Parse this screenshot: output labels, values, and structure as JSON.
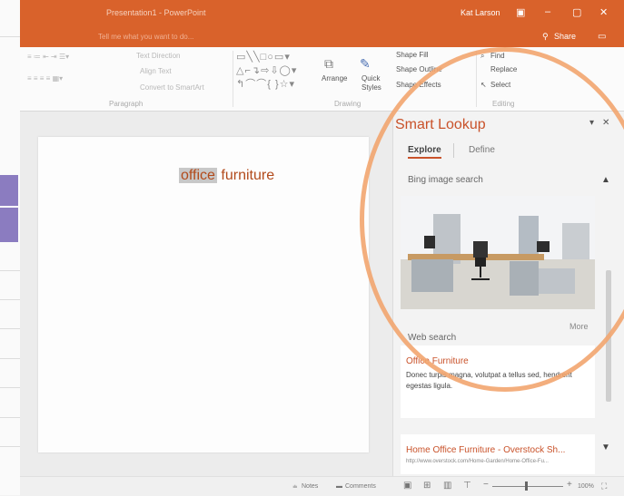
{
  "window": {
    "title": "Presentation1 - PowerPoint",
    "user": "Kat Larson",
    "controls": {
      "restore": "▣",
      "minimize": "–",
      "maximize": "▢",
      "close": "✕"
    }
  },
  "tabs": {
    "tell_me": "Tell me what you want to do...",
    "share_icon": "person-icon",
    "share_label": "Share",
    "comment_icon": "comment-icon"
  },
  "ribbon": {
    "paragraph": {
      "text_direction": "Text Direction",
      "align_text": "Align Text",
      "convert_smartart": "Convert to SmartArt",
      "label": "Paragraph"
    },
    "drawing": {
      "arrange": "Arrange",
      "quick_styles": "Quick Styles",
      "shape_fill": "Shape Fill",
      "shape_outline": "Shape Outline",
      "shape_effects": "Shape Effects",
      "label": "Drawing"
    },
    "editing": {
      "find": "Find",
      "replace": "Replace",
      "select": "Select",
      "label": "Editing"
    }
  },
  "slide": {
    "text_highlighted": "office",
    "text_rest": "furniture"
  },
  "smart_lookup": {
    "title": "Smart Lookup",
    "tabs": [
      "Explore",
      "Define"
    ],
    "image_section": "Bing image search",
    "more": "More",
    "web_section": "Web search",
    "results": [
      {
        "title": "Office Furniture",
        "snippet": "Donec turpis magna, volutpat a tellus sed, hendrerit egestas ligula."
      },
      {
        "title": "Home Office Furniture - Overstock Sh...",
        "url": "http://www.overstock.com/Home-Garden/Home-Office-Fu..."
      }
    ]
  },
  "statusbar": {
    "notes": "Notes",
    "comments": "Comments",
    "zoom": "100%"
  },
  "colors": {
    "accent": "#D9622B",
    "circle": "#F2A56F"
  }
}
